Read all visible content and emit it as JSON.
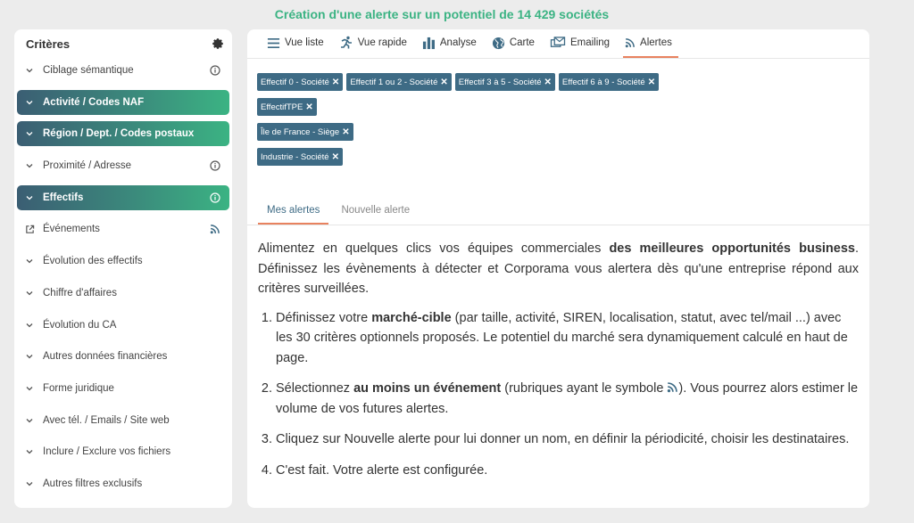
{
  "header": {
    "title": "Création d'une alerte sur un potentiel de 14 429 sociétés"
  },
  "sidebar": {
    "title": "Critères",
    "items": [
      {
        "label": "Ciblage sémantique",
        "active": false,
        "icon": "chevron",
        "right": "info"
      },
      {
        "label": "Activité / Codes NAF",
        "active": true,
        "icon": "chevron",
        "right": ""
      },
      {
        "label": "Région / Dept. / Codes postaux",
        "active": true,
        "icon": "chevron",
        "right": ""
      },
      {
        "label": "Proximité / Adresse",
        "active": false,
        "icon": "chevron",
        "right": "info"
      },
      {
        "label": "Effectifs",
        "active": true,
        "icon": "chevron",
        "right": "info"
      },
      {
        "label": "Événements",
        "active": false,
        "icon": "external",
        "right": "rss"
      },
      {
        "label": "Évolution des effectifs",
        "active": false,
        "icon": "chevron",
        "right": ""
      },
      {
        "label": "Chiffre d'affaires",
        "active": false,
        "icon": "chevron",
        "right": ""
      },
      {
        "label": "Évolution du CA",
        "active": false,
        "icon": "chevron",
        "right": ""
      },
      {
        "label": "Autres données financières",
        "active": false,
        "icon": "chevron",
        "right": ""
      },
      {
        "label": "Forme juridique",
        "active": false,
        "icon": "chevron",
        "right": ""
      },
      {
        "label": "Avec tél. / Emails / Site web",
        "active": false,
        "icon": "chevron",
        "right": ""
      },
      {
        "label": "Inclure / Exclure vos fichiers",
        "active": false,
        "icon": "chevron",
        "right": ""
      },
      {
        "label": "Autres filtres exclusifs",
        "active": false,
        "icon": "chevron",
        "right": ""
      }
    ]
  },
  "tabs": [
    {
      "label": "Vue liste",
      "icon": "list-icon",
      "active": false
    },
    {
      "label": "Vue rapide",
      "icon": "runner-icon",
      "active": false
    },
    {
      "label": "Analyse",
      "icon": "bar-chart-icon",
      "active": false
    },
    {
      "label": "Carte",
      "icon": "globe-icon",
      "active": false
    },
    {
      "label": "Emailing",
      "icon": "emailing-icon",
      "active": false
    },
    {
      "label": "Alertes",
      "icon": "rss-icon",
      "active": true
    }
  ],
  "filter_tags": [
    [
      "Effectif 0 - Société",
      "Effectif 1 ou 2 - Société",
      "Effectif 3 à 5 - Société",
      "Effectif 6 à 9 - Société"
    ],
    [
      "EffectifTPE"
    ],
    [
      "Île de France - Siège"
    ],
    [
      "Industrie - Société"
    ]
  ],
  "tag_close_glyph": "✕",
  "subtabs": [
    {
      "label": "Mes alertes",
      "active": true
    },
    {
      "label": "Nouvelle alerte",
      "active": false
    }
  ],
  "content": {
    "intro_before": "Alimentez en quelques clics vos équipes commerciales ",
    "intro_bold": "des meilleures opportunités business",
    "intro_after": ". Définissez les évènements à détecter et Corporama vous alertera dès qu'une entreprise répond aux critères surveillées.",
    "step1_before": "Définissez votre ",
    "step1_bold": "marché-cible",
    "step1_after": " (par taille, activité, SIREN, localisation, statut, avec tel/mail ...) avec les 30 critères optionnels proposés. Le potentiel du marché sera dynamiquement calculé en haut de page.",
    "step2_before": "Sélectionnez ",
    "step2_bold": "au moins un événement",
    "step2_mid": " (rubriques ayant le symbole ",
    "step2_after": "). Vous pourrez alors estimer le volume de vos futures alertes.",
    "step3": "Cliquez sur Nouvelle alerte pour lui donner un nom, en définir la périodicité, choisir les destinataires.",
    "step4": "C'est fait. Votre alerte est configurée."
  },
  "colors": {
    "accent_green": "#3bb383",
    "tag_blue": "#3e6b85",
    "tab_underline": "#e8825f"
  }
}
